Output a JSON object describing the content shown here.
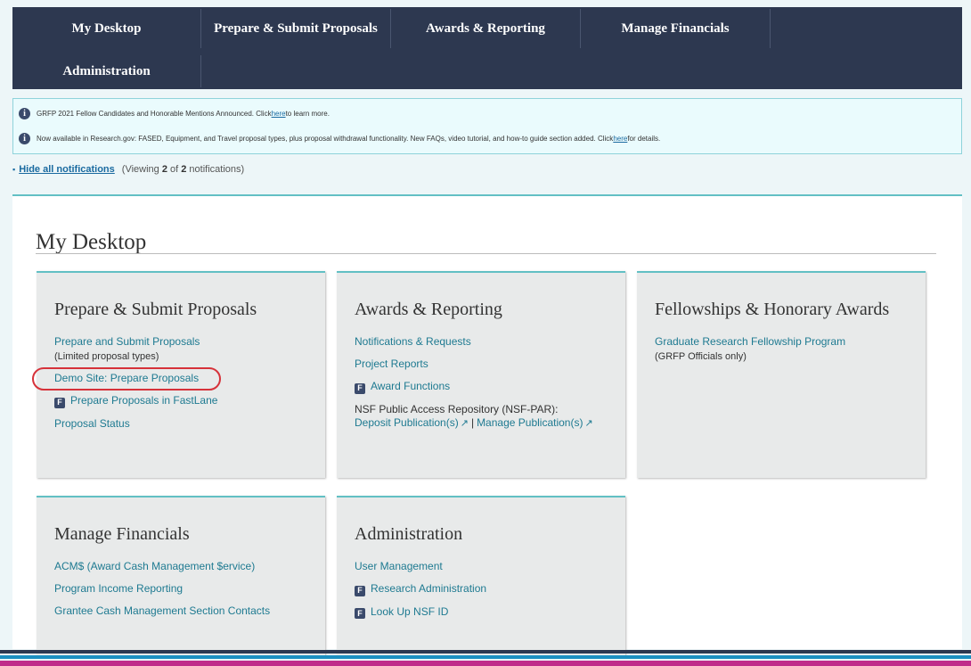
{
  "nav": {
    "items": [
      "My Desktop",
      "Prepare & Submit Proposals",
      "Awards & Reporting",
      "Manage Financials",
      "Administration"
    ]
  },
  "notifications": {
    "items": [
      {
        "pre": "GRFP 2021 Fellow Candidates and Honorable Mentions Announced. Click ",
        "link": "here",
        "post": " to learn more."
      },
      {
        "pre": "Now available in Research.gov: FASED, Equipment, and Travel proposal types, plus proposal withdrawal functionality. New FAQs, video tutorial, and how-to guide section added. Click ",
        "link": "here",
        "post": " for details."
      }
    ],
    "hide_label": "Hide all notifications",
    "viewing_pre": "(Viewing ",
    "viewing_count": "2",
    "viewing_mid": " of ",
    "viewing_total": "2",
    "viewing_post": " notifications)"
  },
  "main": {
    "title": "My Desktop",
    "cards": {
      "prepare": {
        "title": "Prepare & Submit Proposals",
        "link1": "Prepare and Submit Proposals",
        "link1_sub": "(Limited proposal types)",
        "link2": "Demo Site: Prepare Proposals",
        "link3": "Prepare Proposals in FastLane",
        "link4": "Proposal Status"
      },
      "awards": {
        "title": "Awards & Reporting",
        "link1": "Notifications & Requests",
        "link2": "Project Reports",
        "link3": "Award Functions",
        "par_label": "NSF Public Access Repository (NSF-PAR):",
        "deposit": "Deposit Publication(s)",
        "separator": "|",
        "manage": "Manage Publication(s)"
      },
      "fellowships": {
        "title": "Fellowships & Honorary Awards",
        "link1": "Graduate Research Fellowship Program",
        "link1_sub": "(GRFP Officials only)"
      },
      "financials": {
        "title": "Manage Financials",
        "link1": "ACM$ (Award Cash Management $ervice)",
        "link2": "Program Income Reporting",
        "link3": "Grantee Cash Management Section Contacts"
      },
      "admin": {
        "title": "Administration",
        "link1": "User Management",
        "link2": "Research Administration",
        "link3": "Look Up NSF ID"
      }
    }
  },
  "icons": {
    "fastlane": "F",
    "info": "i",
    "external": "↗"
  },
  "colors": {
    "nav_bg": "#2d3850",
    "link": "#1e7a91",
    "accent": "#62c0c4",
    "highlight": "#d6323a"
  }
}
